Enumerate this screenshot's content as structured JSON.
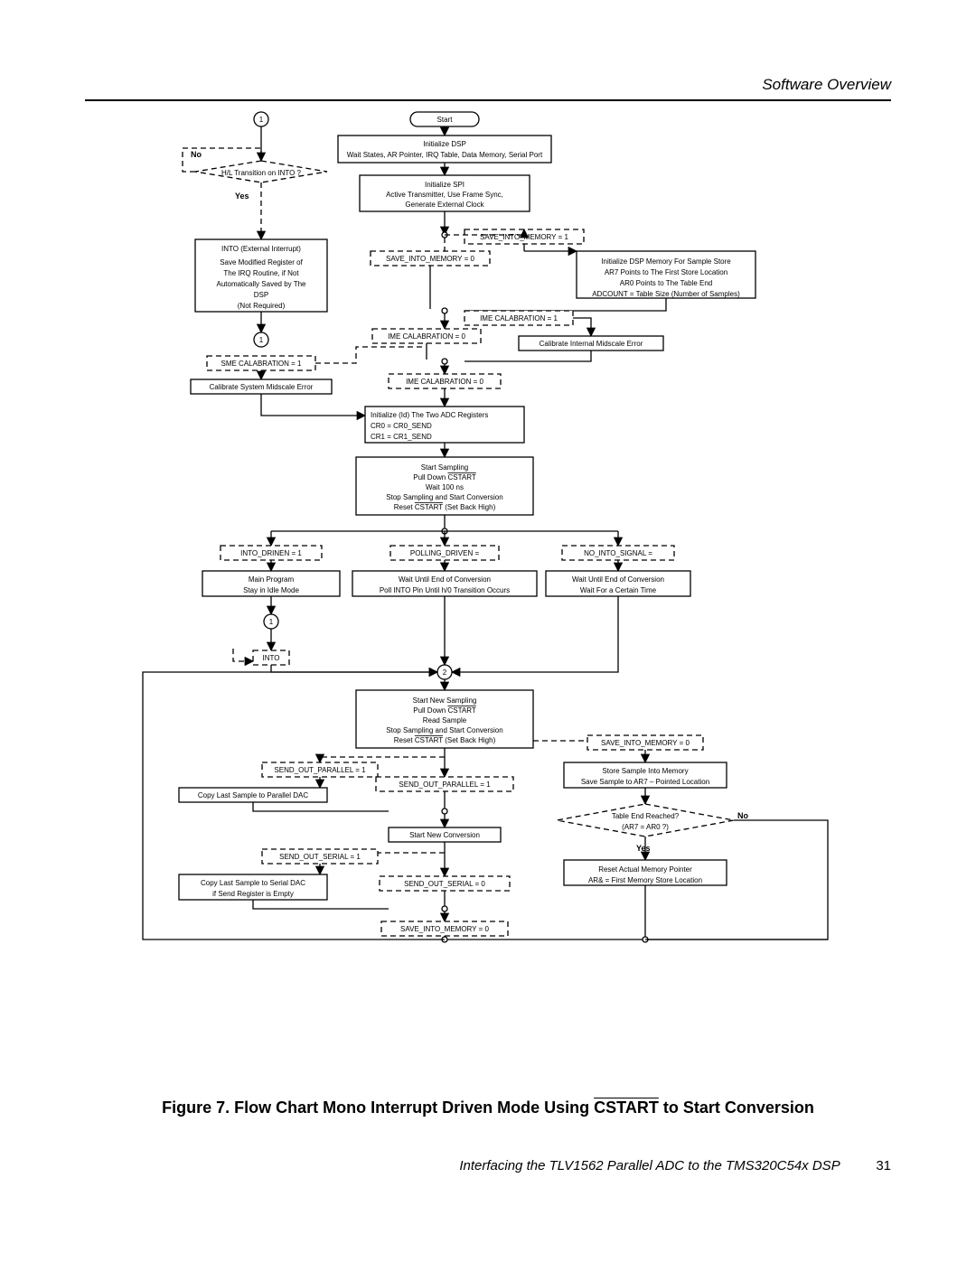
{
  "header": {
    "section_title": "Software Overview"
  },
  "footer": {
    "doc_title": "Interfacing the TLV1562 Parallel ADC to the TMS320C54x DSP",
    "page_number": "31"
  },
  "caption": {
    "figure_label": "Figure 7.  Flow Chart Mono Interrupt Driven Mode Using ",
    "figure_overline": "CSTART",
    "figure_tail": " to Start Conversion"
  },
  "nodes": {
    "c1_top": "1",
    "start": "Start",
    "init_dsp_l1": "Initialize DSP",
    "init_dsp_l2": "Wait States, AR Pointer, IRQ Table, Data Memory, Serial Port",
    "init_spi_l1": "Initialize SPI",
    "init_spi_l2": "Active Transmitter, Use Frame Sync,",
    "init_spi_l3": "Generate External Clock",
    "hl_trans": "H/L Transition on INTO ?",
    "no": "No",
    "yes": "Yes",
    "into_ext_l1": "INTO (External Interrupt)",
    "into_ext_l2": "Save Modified Register of",
    "into_ext_l3": "The IRQ Routine, if Not",
    "into_ext_l4": "Automatically Saved by The",
    "into_ext_l5": "DSP",
    "into_ext_l6": "(Not Required)",
    "c1_left": "1",
    "sme1": "SME CALABRATION = 1",
    "cal_sys": "Calibrate System Midscale Error",
    "save_mem1": "SAVE_INTO_MEMORY = 1",
    "save_mem0": "SAVE_INTO_MEMORY = 0",
    "init_mem_l1": "Initialize DSP Memory For Sample Store",
    "init_mem_l2": "AR7 Points to The First Store Location",
    "init_mem_l3": "AR0 Points to The Table End",
    "init_mem_l4": "ADCOUNT = Table Size (Number of Samples)",
    "ime1": "IME CALABRATION = 1",
    "ime0": "IME CALABRATION = 0",
    "ime0b": "IME CALABRATION = 0",
    "cal_int": "Calibrate Internal Midscale Error",
    "init_adc_l1": "Initialize (Id) The Two ADC Registers",
    "init_adc_l2": "CR0 = CR0_SEND",
    "init_adc_l3": "CR1 = CR1_SEND",
    "start_samp_l1": "Start Sampling",
    "start_samp_l2": "Pull Down CSTART",
    "start_samp_l3": "Wait 100 ns",
    "start_samp_l4": "Stop Sampling and Start Conversion",
    "start_samp_l5": "Reset CSTART (Set Back High)",
    "into_drinen": "INTO_DRINEN = 1",
    "polling_driven": "POLLING_DRIVEN =",
    "no_into": "NO_INTO_SIGNAL =",
    "main_prog_l1": "Main Program",
    "main_prog_l2": "Stay in Idle Mode",
    "poll_l1": "Wait Until End of Conversion",
    "poll_l2": "Poll INTO Pin Until h/0 Transition Occurs",
    "wait_l1": "Wait Until End of Conversion",
    "wait_l2": "Wait For a Certain Time",
    "c1_bottom": "1",
    "into_dash": "INTO",
    "c2": "2",
    "new_samp_l1": "Start New Sampling",
    "new_samp_l2": "Pull Down CSTART",
    "new_samp_l3": "Read Sample",
    "new_samp_l4": "Stop Sampling and Start Conversion",
    "new_samp_l5": "Reset CSTART (Set Back High)",
    "send_par1": "SEND_OUT_PARALLEL = 1",
    "copy_par": "Copy Last Sample to Parallel DAC",
    "send_par0": "SEND_OUT_PARALLEL = 1",
    "start_new_conv": "Start New Conversion",
    "send_ser1": "SEND_OUT_SERIAL = 1",
    "copy_ser_l1": "Copy Last Sample to Serial DAC",
    "copy_ser_l2": "if Send Register is Empty",
    "send_ser0": "SEND_OUT_SERIAL = 0",
    "save_mem0b": "SAVE_INTO_MEMORY = 0",
    "save_mem0r": "SAVE_INTO_MEMORY = 0",
    "store_l1": "Store Sample Into Memory",
    "store_l2": "Save Sample to AR7 – Pointed Location",
    "table_end_l1": "Table End Reached?",
    "table_end_l2": "(AR7 = AR0 ?)",
    "no2": "No",
    "yes2": "Yes",
    "reset_l1": "Reset Actual Memory Pointer",
    "reset_l2": "AR& = First Memory Store Location"
  }
}
